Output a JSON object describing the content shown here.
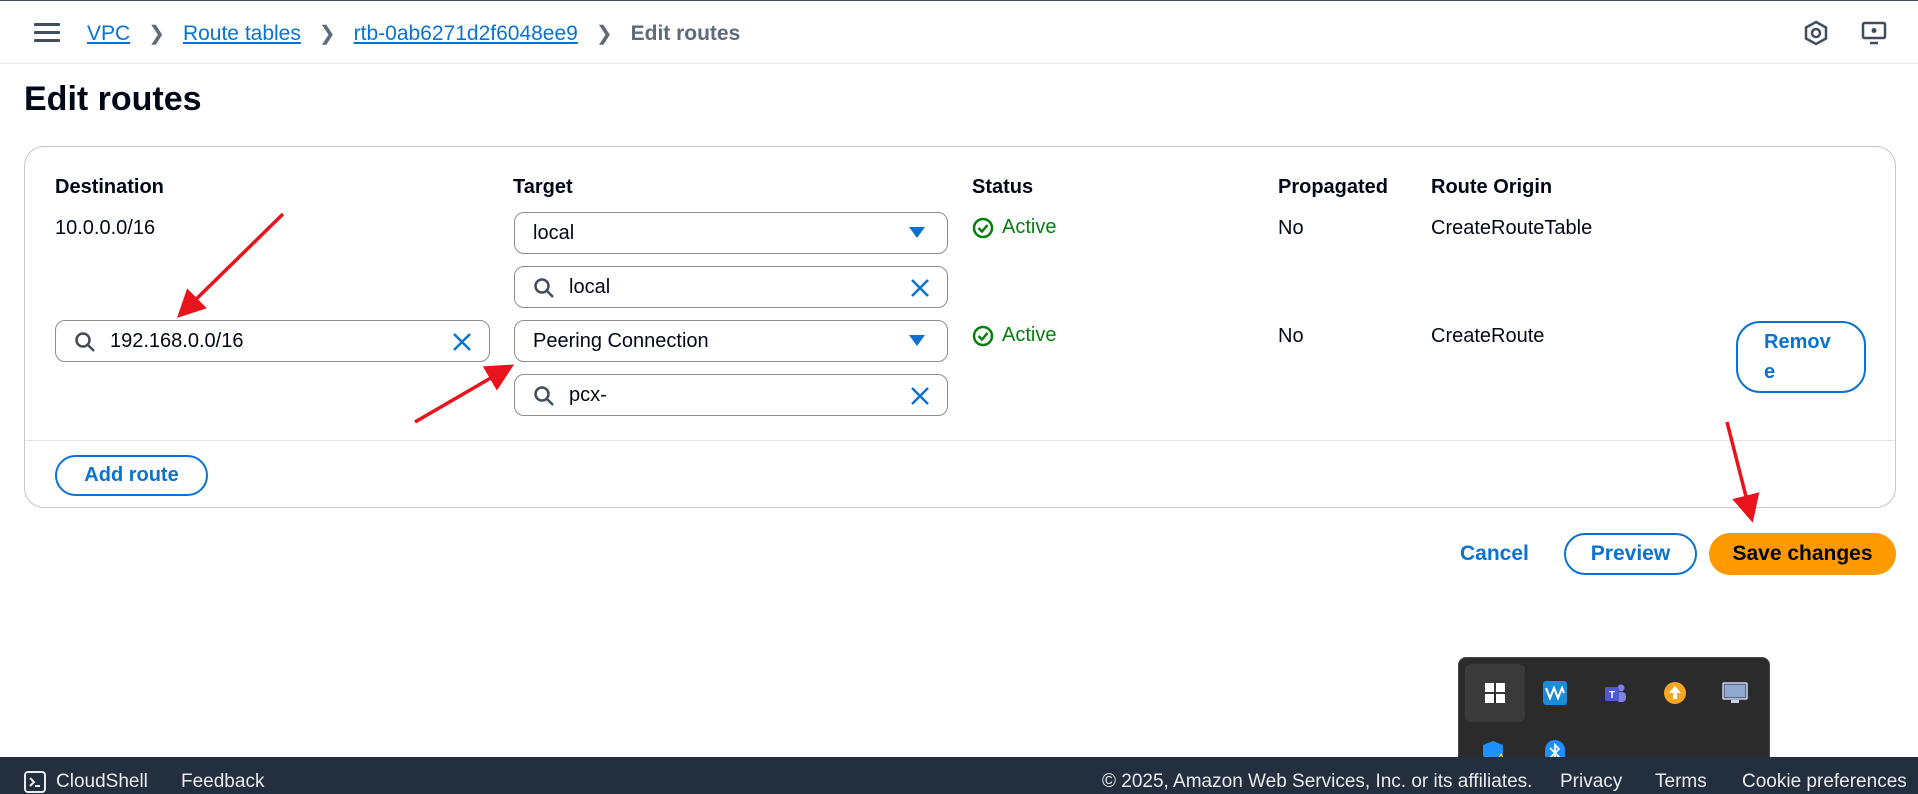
{
  "breadcrumb": {
    "items": [
      "VPC",
      "Route tables",
      "rtb-0ab6271d2f6048ee9"
    ],
    "current": "Edit routes"
  },
  "page_title": "Edit routes",
  "table": {
    "headers": {
      "destination": "Destination",
      "target": "Target",
      "status": "Status",
      "propagated": "Propagated",
      "route_origin": "Route Origin"
    },
    "rows": [
      {
        "destination": "10.0.0.0/16",
        "target_selected": "local",
        "target_search": "local",
        "status": "Active",
        "propagated": "No",
        "route_origin": "CreateRouteTable"
      },
      {
        "destination": "192.168.0.0/16",
        "target_selected": "Peering Connection",
        "target_search": "pcx-",
        "status": "Active",
        "propagated": "No",
        "route_origin": "CreateRoute",
        "remove_label_line1": "Remov",
        "remove_label_line2": "e"
      }
    ]
  },
  "actions": {
    "add_route": "Add route",
    "cancel": "Cancel",
    "preview": "Preview",
    "save": "Save changes"
  },
  "footer": {
    "cloudshell": "CloudShell",
    "feedback": "Feedback",
    "copyright": "© 2025, Amazon Web Services, Inc. or its affiliates.",
    "privacy": "Privacy",
    "terms": "Terms",
    "cookie": "Cookie preferences"
  },
  "colors": {
    "link": "#0972d3",
    "primary": "#ff9900",
    "success": "#037f0c",
    "footer_bg": "#232f3e",
    "annotation_arrow": "#e8131b"
  },
  "tray_icons": [
    "pin-icon",
    "waves-app-icon",
    "teams-icon",
    "update-icon",
    "display-icon",
    "security-warning-icon",
    "bluetooth-icon"
  ]
}
